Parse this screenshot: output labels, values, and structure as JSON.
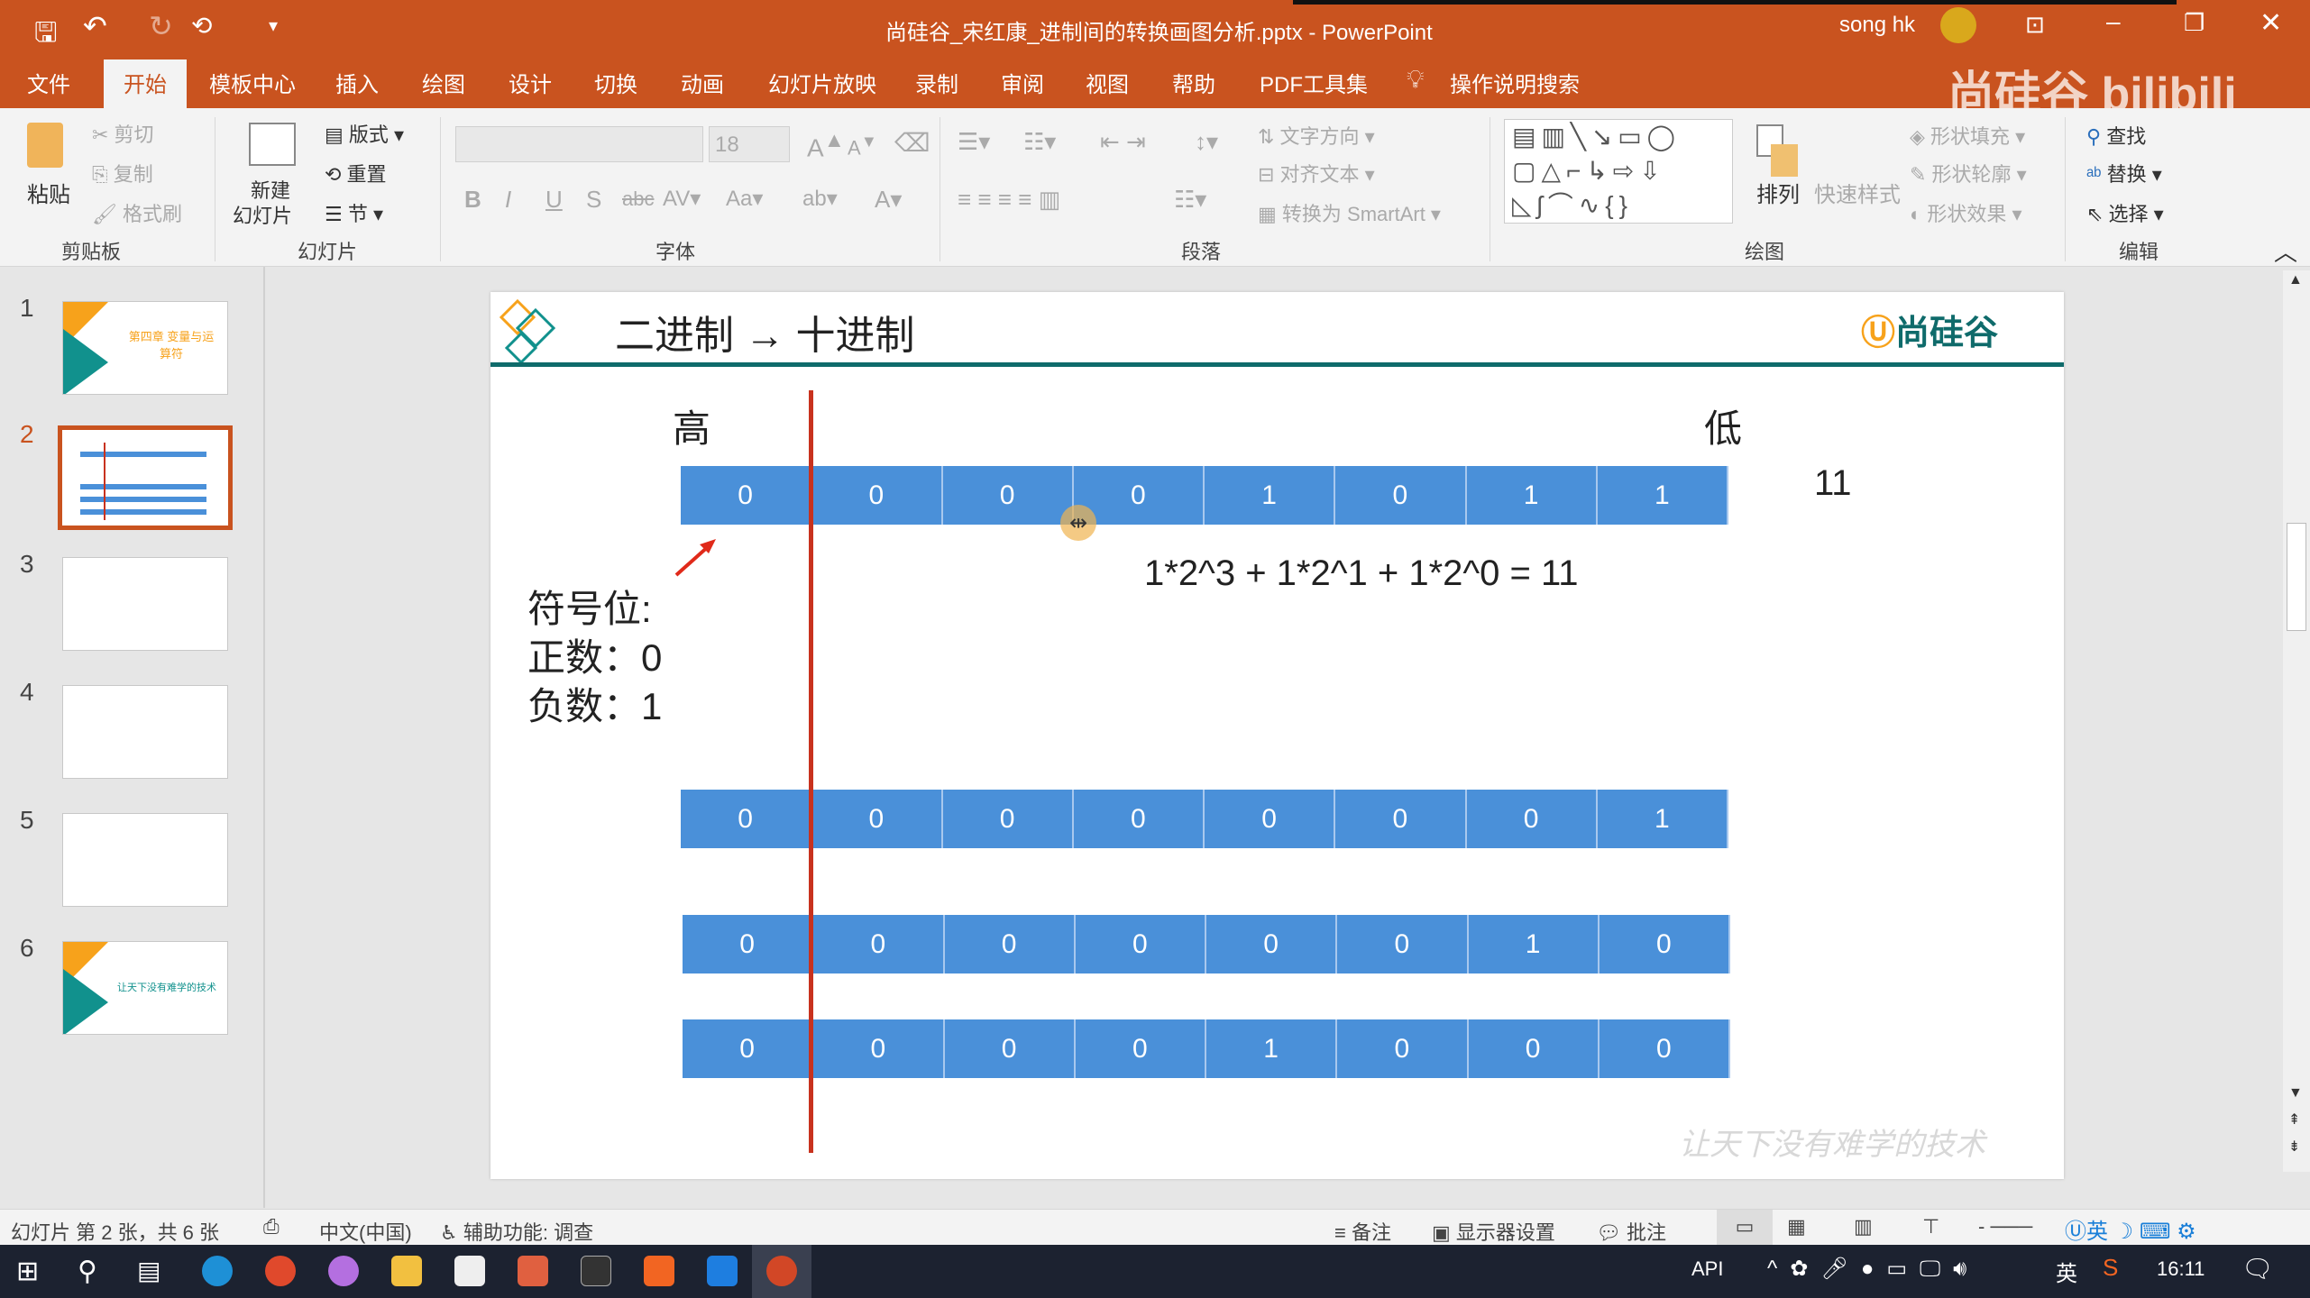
{
  "titlebar": {
    "title": "尚硅谷_宋红康_进制间的转换画图分析.pptx - PowerPoint",
    "user": "song hk",
    "watermark": "尚硅谷 bilibili"
  },
  "tabs": [
    "文件",
    "开始",
    "模板中心",
    "插入",
    "绘图",
    "设计",
    "切换",
    "动画",
    "幻灯片放映",
    "录制",
    "审阅",
    "视图",
    "帮助",
    "PDF工具集",
    "操作说明搜索"
  ],
  "active_tab": "开始",
  "ribbon": {
    "clipboard": {
      "paste": "粘贴",
      "cut": "剪切",
      "copy": "复制",
      "format_painter": "格式刷",
      "label": "剪贴板"
    },
    "slides": {
      "new_slide_1": "新建",
      "new_slide_2": "幻灯片",
      "layout": "版式",
      "reset": "重置",
      "section": "节",
      "label": "幻灯片"
    },
    "font": {
      "font_name": "",
      "font_size": "18",
      "label": "字体"
    },
    "paragraph": {
      "text_direction": "文字方向",
      "align_text": "对齐文本",
      "smartart": "转换为 SmartArt",
      "label": "段落"
    },
    "drawing": {
      "arrange": "排列",
      "quick_styles": "快速样式",
      "shape_fill": "形状填充",
      "shape_outline": "形状轮廓",
      "shape_effects": "形状效果",
      "label": "绘图"
    },
    "editing": {
      "find": "查找",
      "replace": "替换",
      "select": "选择",
      "label": "编辑"
    }
  },
  "thumbnails": [
    {
      "num": "1",
      "text": "第四章 变量与运算符"
    },
    {
      "num": "2",
      "text": ""
    },
    {
      "num": "3",
      "text": ""
    },
    {
      "num": "4",
      "text": ""
    },
    {
      "num": "5",
      "text": ""
    },
    {
      "num": "6",
      "text": "让天下没有难学的技术"
    }
  ],
  "slide": {
    "title": "二进制 → 十进制",
    "logo": "尚硅谷",
    "high": "高",
    "low": "低",
    "rows": [
      [
        "0",
        "0",
        "0",
        "0",
        "1",
        "0",
        "1",
        "1"
      ],
      [
        "0",
        "0",
        "0",
        "0",
        "0",
        "0",
        "0",
        "1"
      ],
      [
        "0",
        "0",
        "0",
        "0",
        "0",
        "0",
        "1",
        "0"
      ],
      [
        "0",
        "0",
        "0",
        "0",
        "1",
        "0",
        "0",
        "0"
      ]
    ],
    "result": "11",
    "formula": "1*2^3 + 1*2^1 + 1*2^0 = 11",
    "sign_title": "符号位:",
    "positive": "正数：0",
    "negative": "负数：1",
    "footer": "让天下没有难学的技术",
    "colors": {
      "cell": "#4a90d9",
      "sign_line": "#c8321e",
      "header_line": "#0f6b6b"
    }
  },
  "status": {
    "slide_info": "幻灯片 第 2 张，共 6 张",
    "language": "中文(中国)",
    "accessibility": "辅助功能: 调查",
    "notes": "备注",
    "display": "显示器设置",
    "comments": "批注"
  },
  "taskbar": {
    "api": "API",
    "ime": "英",
    "time": "16:11"
  }
}
